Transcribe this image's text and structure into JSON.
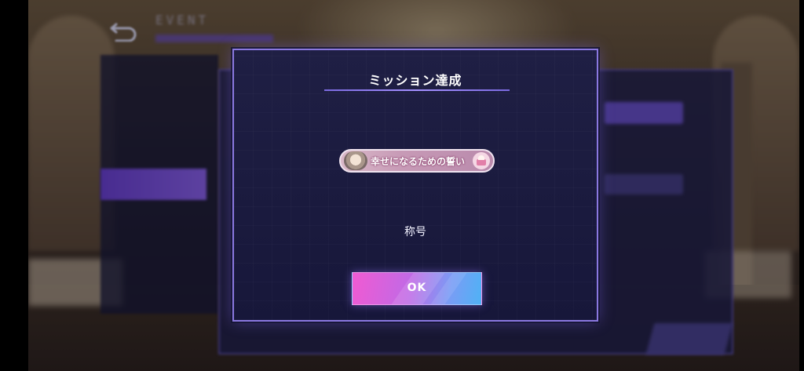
{
  "dialog": {
    "title": "ミッション達成",
    "reward_badge_label": "幸せになるための誓い",
    "reward_type": "称号",
    "ok_label": "OK"
  },
  "colors": {
    "modal_border": "#8a78e0",
    "ok_gradient_start": "#f05ad2",
    "ok_gradient_end": "#4fb2f5",
    "badge_base": "#c79ab6"
  },
  "icons": {
    "back": "back-arrow-icon",
    "badge_avatar": "character-portrait-icon",
    "badge_cake": "cake-icon"
  }
}
